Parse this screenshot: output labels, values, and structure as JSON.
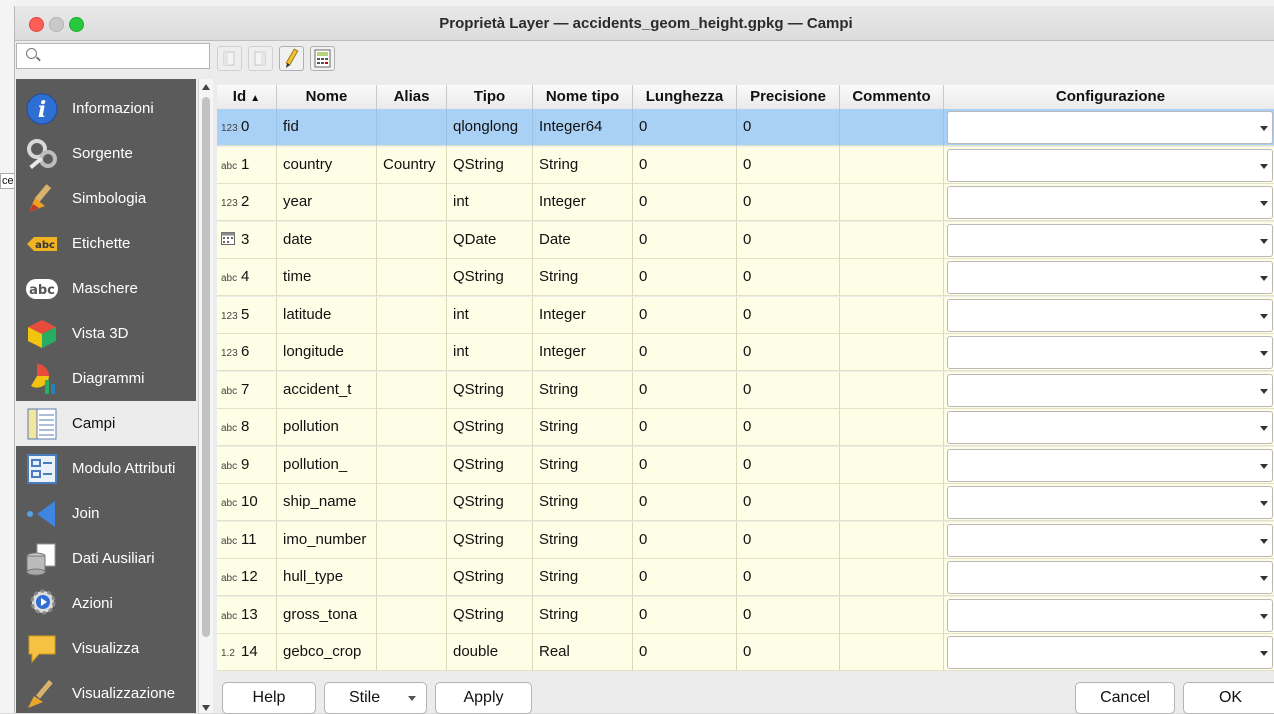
{
  "window": {
    "title": "Proprietà Layer — accidents_geom_height.gpkg — Campi"
  },
  "background": {
    "fragment": "cel"
  },
  "search": {
    "placeholder": ""
  },
  "sidebar": {
    "items": [
      {
        "label": "Informazioni",
        "icon": "info-icon"
      },
      {
        "label": "Sorgente",
        "icon": "source-tools-icon"
      },
      {
        "label": "Simbologia",
        "icon": "brush-icon"
      },
      {
        "label": "Etichette",
        "icon": "labels-icon"
      },
      {
        "label": "Maschere",
        "icon": "masks-icon"
      },
      {
        "label": "Vista 3D",
        "icon": "cube-3d-icon"
      },
      {
        "label": "Diagrammi",
        "icon": "diagram-icon"
      },
      {
        "label": "Campi",
        "icon": "fields-icon",
        "active": true
      },
      {
        "label": "Modulo Attributi",
        "icon": "attribute-form-icon"
      },
      {
        "label": "Join",
        "icon": "join-icon"
      },
      {
        "label": "Dati Ausiliari",
        "icon": "auxiliary-data-icon"
      },
      {
        "label": "Azioni",
        "icon": "actions-gear-icon"
      },
      {
        "label": "Visualizza",
        "icon": "display-bubble-icon"
      },
      {
        "label": "Visualizzazione",
        "icon": "rendering-brush-icon"
      }
    ]
  },
  "table": {
    "headers": [
      "Id",
      "Nome",
      "Alias",
      "Tipo",
      "Nome tipo",
      "Lunghezza",
      "Precisione",
      "Commento",
      "Configurazione"
    ],
    "rows": [
      {
        "badge": "123",
        "id": "0",
        "name": "fid",
        "alias": "",
        "type": "qlonglong",
        "type_name": "Integer64",
        "length": "0",
        "precision": "0",
        "comment": "",
        "selected": true
      },
      {
        "badge": "abc",
        "id": "1",
        "name": "country",
        "alias": "Country",
        "type": "QString",
        "type_name": "String",
        "length": "0",
        "precision": "0",
        "comment": ""
      },
      {
        "badge": "123",
        "id": "2",
        "name": "year",
        "alias": "",
        "type": "int",
        "type_name": "Integer",
        "length": "0",
        "precision": "0",
        "comment": ""
      },
      {
        "badge": "cal",
        "id": "3",
        "name": "date",
        "alias": "",
        "type": "QDate",
        "type_name": "Date",
        "length": "0",
        "precision": "0",
        "comment": ""
      },
      {
        "badge": "abc",
        "id": "4",
        "name": "time",
        "alias": "",
        "type": "QString",
        "type_name": "String",
        "length": "0",
        "precision": "0",
        "comment": ""
      },
      {
        "badge": "123",
        "id": "5",
        "name": "latitude",
        "alias": "",
        "type": "int",
        "type_name": "Integer",
        "length": "0",
        "precision": "0",
        "comment": ""
      },
      {
        "badge": "123",
        "id": "6",
        "name": "longitude",
        "alias": "",
        "type": "int",
        "type_name": "Integer",
        "length": "0",
        "precision": "0",
        "comment": ""
      },
      {
        "badge": "abc",
        "id": "7",
        "name": "accident_t",
        "alias": "",
        "type": "QString",
        "type_name": "String",
        "length": "0",
        "precision": "0",
        "comment": ""
      },
      {
        "badge": "abc",
        "id": "8",
        "name": "pollution",
        "alias": "",
        "type": "QString",
        "type_name": "String",
        "length": "0",
        "precision": "0",
        "comment": ""
      },
      {
        "badge": "abc",
        "id": "9",
        "name": "pollution_",
        "alias": "",
        "type": "QString",
        "type_name": "String",
        "length": "0",
        "precision": "0",
        "comment": ""
      },
      {
        "badge": "abc",
        "id": "10",
        "name": "ship_name",
        "alias": "",
        "type": "QString",
        "type_name": "String",
        "length": "0",
        "precision": "0",
        "comment": ""
      },
      {
        "badge": "abc",
        "id": "11",
        "name": "imo_number",
        "alias": "",
        "type": "QString",
        "type_name": "String",
        "length": "0",
        "precision": "0",
        "comment": ""
      },
      {
        "badge": "abc",
        "id": "12",
        "name": "hull_type",
        "alias": "",
        "type": "QString",
        "type_name": "String",
        "length": "0",
        "precision": "0",
        "comment": ""
      },
      {
        "badge": "abc",
        "id": "13",
        "name": "gross_tona",
        "alias": "",
        "type": "QString",
        "type_name": "String",
        "length": "0",
        "precision": "0",
        "comment": ""
      },
      {
        "badge": "1.2",
        "id": "14",
        "name": "gebco_crop",
        "alias": "",
        "type": "double",
        "type_name": "Real",
        "length": "0",
        "precision": "0",
        "comment": ""
      }
    ]
  },
  "buttons": {
    "help": "Help",
    "style": "Stile",
    "apply": "Apply",
    "cancel": "Cancel",
    "ok": "OK"
  },
  "colors": {
    "selected_row": "#a8d1f5",
    "row_bg": "#fefde6",
    "sidebar_bg": "#5b5b5b"
  }
}
